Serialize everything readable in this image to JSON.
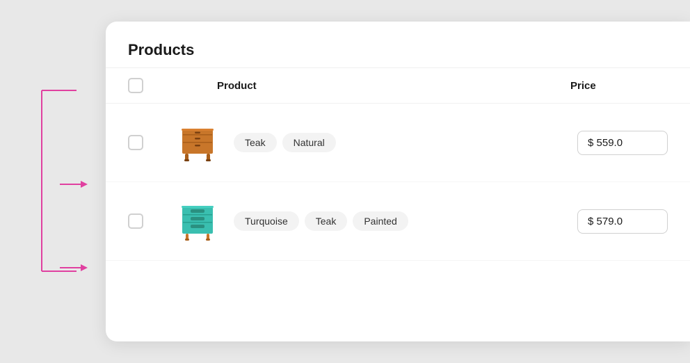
{
  "page": {
    "background": "#e8e8e8"
  },
  "card": {
    "title": "Products"
  },
  "table": {
    "columns": [
      {
        "label": ""
      },
      {
        "label": "Product"
      },
      {
        "label": "Price"
      }
    ],
    "rows": [
      {
        "tags": [
          "Teak",
          "Natural"
        ],
        "price": "$ 559.0",
        "image_alt": "teak dresser natural"
      },
      {
        "tags": [
          "Turquoise",
          "Teak",
          "Painted"
        ],
        "price": "$ 579.0",
        "image_alt": "turquoise teak painted dresser"
      }
    ]
  },
  "annotations": {
    "arrow_color": "#e040a0"
  }
}
